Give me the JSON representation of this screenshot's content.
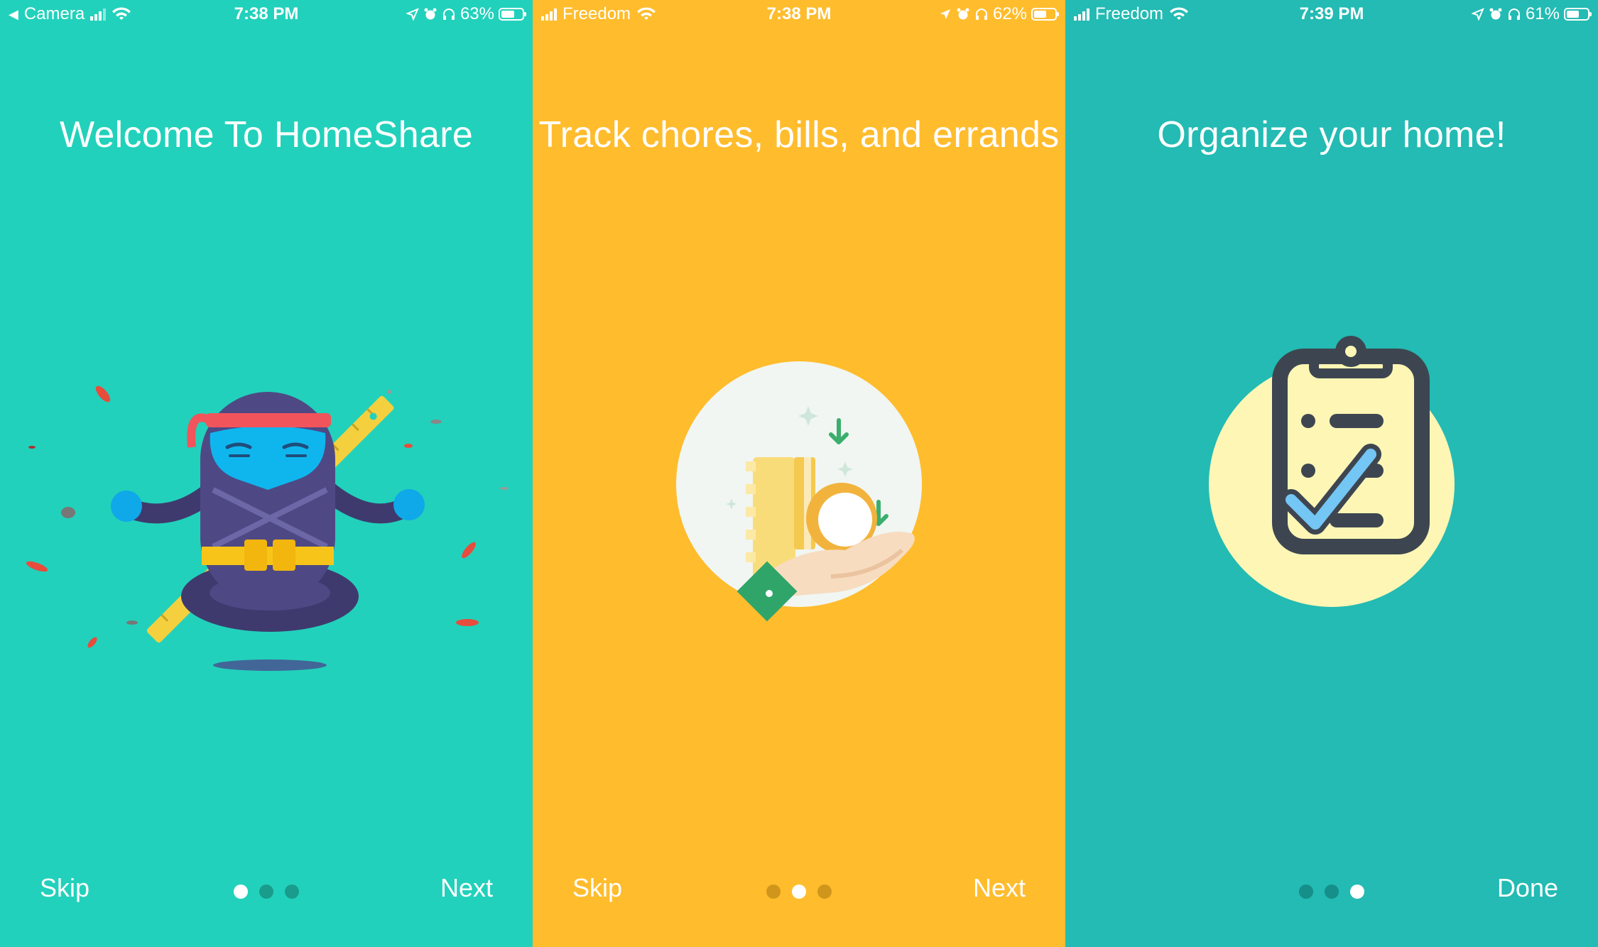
{
  "screens": [
    {
      "status": {
        "carrier": "Camera",
        "back_indicator": "◀",
        "time": "7:38 PM",
        "battery": "63%",
        "battery_level": 0.63
      },
      "title": "Welcome To HomeShare",
      "illustration": "ninja-meditating",
      "skip_label": "Skip",
      "action_label": "Next",
      "page_count": 3,
      "active_page": 1,
      "background": "#22D1BB"
    },
    {
      "status": {
        "carrier": "Freedom",
        "time": "7:38 PM",
        "battery": "62%",
        "battery_level": 0.62
      },
      "title": "Track chores, bills, and errands",
      "illustration": "coins-in-hand",
      "skip_label": "Skip",
      "action_label": "Next",
      "page_count": 3,
      "active_page": 2,
      "background": "#FFBC2C"
    },
    {
      "status": {
        "carrier": "Freedom",
        "time": "7:39 PM",
        "battery": "61%",
        "battery_level": 0.61
      },
      "title": "Organize your home!",
      "illustration": "clipboard-checklist",
      "action_label": "Done",
      "page_count": 3,
      "active_page": 3,
      "background": "#23BBB3"
    }
  ],
  "icons": [
    "signal-icon",
    "wifi-icon",
    "location-arrow-icon",
    "alarm-icon",
    "headphones-icon",
    "battery-icon"
  ]
}
